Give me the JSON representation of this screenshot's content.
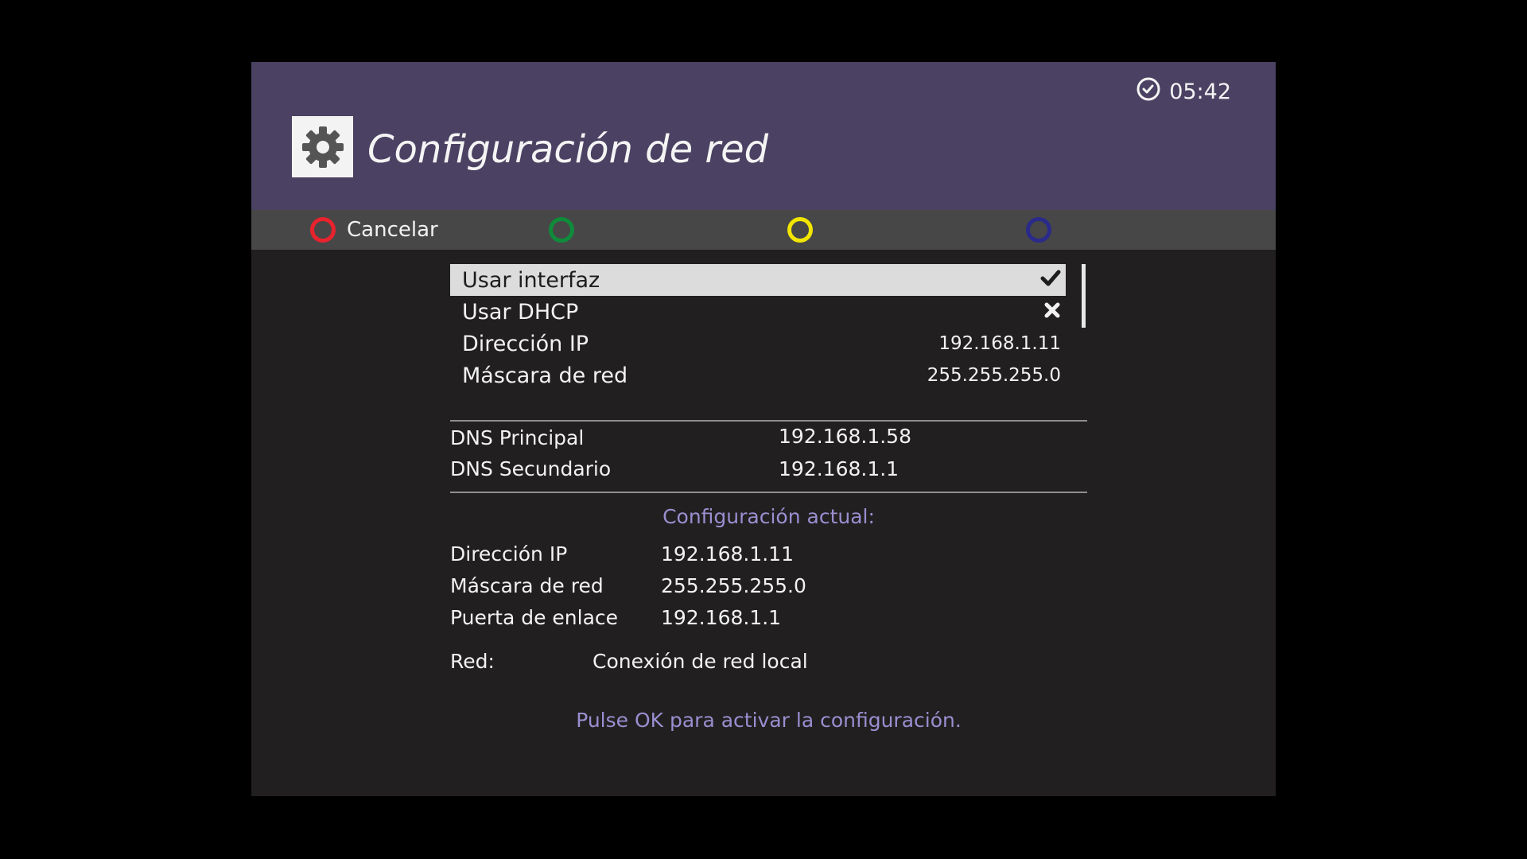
{
  "header": {
    "title": "Configuración de red",
    "clock": "05:42",
    "icons": {
      "settings": "gear-icon",
      "clock": "clock-icon"
    }
  },
  "buttons": {
    "red_label": "Cancelar",
    "green_label": "",
    "yellow_label": "",
    "blue_label": ""
  },
  "colors": {
    "header_bg": "#4b4263",
    "body_bg": "#221f20",
    "bar_bg": "#474747",
    "red": "#e8232d",
    "green": "#0f8b3b",
    "yellow": "#f2e600",
    "blue": "#2a2a8a",
    "accent_text": "#9b8ed0"
  },
  "menu": {
    "items": [
      {
        "label": "Usar interfaz",
        "value_icon": "check-icon",
        "selected": true
      },
      {
        "label": "Usar DHCP",
        "value_icon": "cross-icon"
      },
      {
        "label": "Dirección IP",
        "value": "192.168.1.11"
      },
      {
        "label": "Máscara de red",
        "value": "255.255.255.0"
      }
    ]
  },
  "dns": {
    "primary_label": "DNS Principal",
    "primary_value": "192.168.1.58",
    "secondary_label": "DNS Secundario",
    "secondary_value": "192.168.1.1"
  },
  "current": {
    "heading": "Configuración actual:",
    "ip_label": "Dirección IP",
    "ip_value": "192.168.1.11",
    "mask_label": "Máscara de red",
    "mask_value": "255.255.255.0",
    "gateway_label": "Puerta de enlace",
    "gateway_value": "192.168.1.1",
    "network_label": "Red:",
    "network_value": "Conexión de red local"
  },
  "footer": {
    "hint": "Pulse OK para activar la configuración."
  }
}
